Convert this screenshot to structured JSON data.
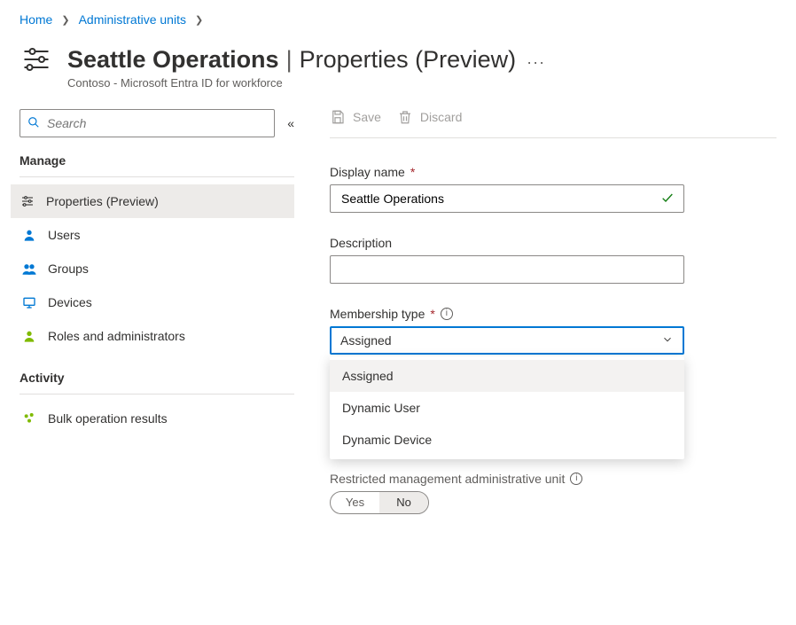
{
  "breadcrumb": {
    "home": "Home",
    "admin_units": "Administrative units"
  },
  "header": {
    "title_bold": "Seattle Operations",
    "title_light": "Properties (Preview)",
    "subtitle": "Contoso - Microsoft Entra ID for workforce",
    "more": "···"
  },
  "search": {
    "placeholder": "Search"
  },
  "sidebar": {
    "section_manage": "Manage",
    "items_manage": [
      {
        "label": "Properties (Preview)"
      },
      {
        "label": "Users"
      },
      {
        "label": "Groups"
      },
      {
        "label": "Devices"
      },
      {
        "label": "Roles and administrators"
      }
    ],
    "section_activity": "Activity",
    "items_activity": [
      {
        "label": "Bulk operation results"
      }
    ]
  },
  "toolbar": {
    "save": "Save",
    "discard": "Discard"
  },
  "form": {
    "display_name_label": "Display name",
    "display_name_value": "Seattle Operations",
    "description_label": "Description",
    "description_value": "",
    "membership_type_label": "Membership type",
    "membership_type_value": "Assigned",
    "membership_options": {
      "o0": "Assigned",
      "o1": "Dynamic User",
      "o2": "Dynamic Device"
    },
    "restricted_label": "Restricted management administrative unit",
    "yes": "Yes",
    "no": "No"
  }
}
